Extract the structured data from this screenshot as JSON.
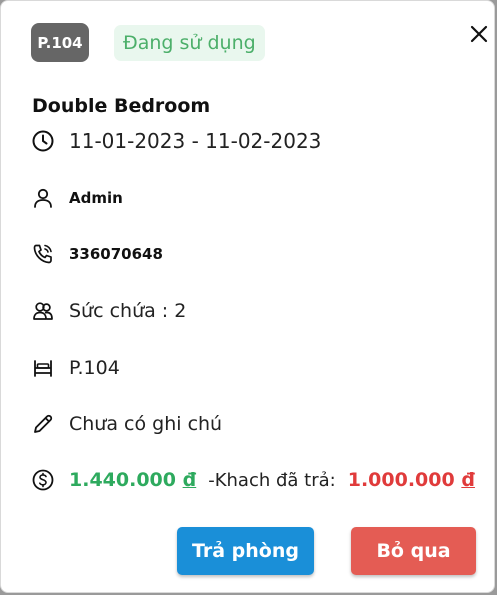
{
  "header": {
    "room_code": "P.104",
    "status": "Đang sử dụng"
  },
  "room_type": "Double Bedroom",
  "details": {
    "date_range": "11-01-2023 - 11-02-2023",
    "guest_name": "Admin",
    "phone": "336070648",
    "capacity": "Sức chứa : 2",
    "room": "P.104",
    "note": "Chưa có ghi chú"
  },
  "payment": {
    "total": "1.440.000",
    "currency": "đ",
    "paid_label": "-Khach đã trả:",
    "paid": "1.000.000"
  },
  "buttons": {
    "checkout": "Trả phòng",
    "cancel": "Bỏ qua"
  },
  "colors": {
    "room_badge": "#666666",
    "status_bg": "#e9f7ee",
    "status_text": "#4caf6a",
    "total": "#2eaa5e",
    "paid": "#e03b3b",
    "checkout_button": "#1a8fd8",
    "cancel_button": "#e45c54"
  },
  "icons": [
    "close-icon",
    "clock-icon",
    "user-icon",
    "phone-icon",
    "users-icon",
    "bed-icon",
    "pencil-icon",
    "dollar-coin-icon"
  ]
}
